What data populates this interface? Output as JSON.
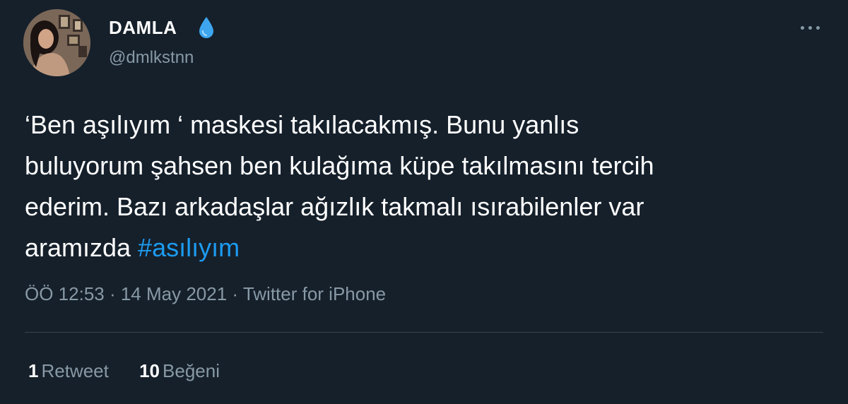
{
  "user": {
    "display_name": "DAMLA",
    "handle": "@dmlkstnn",
    "name_emoji": "droplet-icon"
  },
  "tweet": {
    "lines": [
      "‘Ben aşılıyım ‘ maskesi takılacakmış. Bunu yanlıs",
      "buluyorum şahsen ben kulağıma küpe takılmasını tercih",
      "ederim. Bazı arkadaşlar ağızlık takmalı ısırabilenler var"
    ],
    "last_line_text": "aramızda ",
    "hashtag": "#asılıyım"
  },
  "meta": {
    "time": "ÖÖ 12:53",
    "separator": " · ",
    "date": "14 May 2021",
    "source": "Twitter for iPhone"
  },
  "stats": {
    "retweets_count": "1",
    "retweets_label": "Retweet",
    "likes_count": "10",
    "likes_label": "Beğeni"
  },
  "colors": {
    "background": "#15202b",
    "text": "#ffffff",
    "secondary": "#8899a6",
    "accent": "#1d9bf0",
    "divider": "#38444d"
  }
}
